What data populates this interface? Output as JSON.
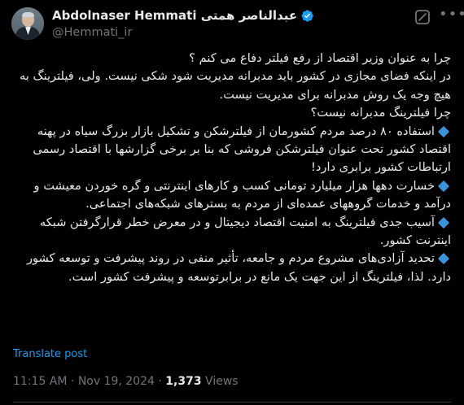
{
  "author": {
    "display_name": "Abdolnaser Hemmati عبدالناصر همتی",
    "handle": "@Hemmati_ir",
    "verified": true
  },
  "tweet": {
    "lines": [
      "چرا به عنوان وزیر اقتصاد از رفع فیلتر دفاع می کنم ؟",
      "در اینکه فضای مجازی در کشور باید مدبرانه مدیریت شود شکی نیست. ولی، فیلترینگ به هیچ وجه یک روش مدبرانه برای مدیریت نیست.",
      "چرا فیلترینگ مدبرانه نیست؟",
      "استفاده ۸۰ درصد مردم کشورمان از فیلترشکن و تشکیل بازار بزرگ سیاه  در پهنه  اقتصاد کشور تحت عنوان فیلترشکن فروشی که بنا بر برخی گزارشها با اقتصاد رسمی ارتباطات کشور برابری دارد!",
      "خسارت دهها هزار میلیارد تومانی کسب و کارهای اینترنتی و گره خوردن معیشت و درآمد و خدمات گروههای عمده‌ای از مردم به بسترهای شبکه‌های اجتماعی.",
      "آسیب جدی فیلترینگ به امنیت اقتصاد دیجیتال و در معرض خطر قرارگرفتن شبکه اینترنت کشور.",
      "تحدید آزادی‌های مشروع مردم و جامعه، تأثیر منفی در روند پیشرفت و توسعه کشور دارد. لذا، فیلترینگ از این جهت یک مانع در برابرتوسعه و پیشرفت کشور است."
    ]
  },
  "translate_label": "Translate post",
  "meta": {
    "time": "11:15 AM",
    "separator": " · ",
    "date": "Nov 19, 2024",
    "views_count": "1,373",
    "views_label": " Views"
  },
  "colors": {
    "background": "#000000",
    "text": "#e7e9ea",
    "secondary": "#71767b",
    "link": "#1d9bf0",
    "bullet": "#3b94d9"
  },
  "icons": {
    "verified": "verified-badge-icon",
    "grok": "grok-icon",
    "more": "more-icon",
    "bullet": "small-blue-diamond-icon"
  }
}
